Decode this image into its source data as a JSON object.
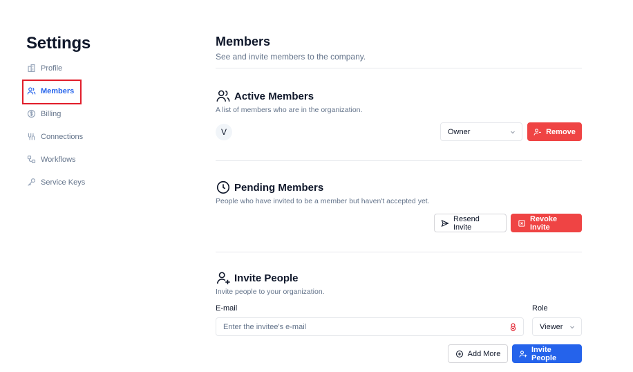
{
  "sidebar": {
    "title": "Settings",
    "items": [
      {
        "label": "Profile",
        "icon": "building-icon"
      },
      {
        "label": "Members",
        "icon": "users-icon",
        "active": true
      },
      {
        "label": "Billing",
        "icon": "dollar-circle-icon"
      },
      {
        "label": "Connections",
        "icon": "plug-icon"
      },
      {
        "label": "Workflows",
        "icon": "workflow-icon"
      },
      {
        "label": "Service Keys",
        "icon": "key-icon"
      }
    ]
  },
  "main": {
    "title": "Members",
    "subtitle": "See and invite members to the company."
  },
  "active_members": {
    "title": "Active Members",
    "subtitle": "A list of members who are in the organization.",
    "member": {
      "avatar_initial": "V",
      "role": "Owner"
    },
    "remove_label": "Remove"
  },
  "pending_members": {
    "title": "Pending Members",
    "subtitle": "People who have invited to be a member but haven't accepted yet.",
    "resend_label": "Resend Invite",
    "revoke_label": "Revoke Invite"
  },
  "invite": {
    "title": "Invite People",
    "subtitle": "Invite people to your organization.",
    "email_label": "E-mail",
    "email_placeholder": "Enter the invitee's e-mail",
    "role_label": "Role",
    "role_value": "Viewer",
    "add_more_label": "Add More",
    "invite_label": "Invite People"
  },
  "colors": {
    "accent": "#2563eb",
    "danger": "#ef4444",
    "highlight": "#e11d2a",
    "muted": "#64748b"
  }
}
